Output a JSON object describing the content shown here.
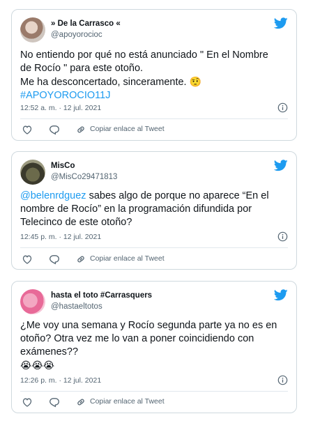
{
  "colors": {
    "link": "#1d9bf0",
    "muted": "#536471",
    "text": "#0f1419",
    "border": "#cfd9de"
  },
  "tweets": [
    {
      "display_name": "» De la Carrasco «",
      "handle": "@apoyorocioc",
      "text_line1": "No entiendo por qué no está anunciado \" En el Nombre",
      "text_line2": "de Rocío \" para este otoño.",
      "text_line3": "Me ha desconcertado, sinceramente. ",
      "emoji": "🤨",
      "hashtag": "#APOYOROCIO11J",
      "timestamp": "12:52 a. m. · 12 jul. 2021",
      "copy_label": "Copiar enlace al Tweet"
    },
    {
      "display_name": "MisCo",
      "handle": "@MisCo29471813",
      "mention": "@belenrdguez",
      "text_line1_rest": " sabes algo de porque no aparece “En el",
      "text_line2": "nombre de Rocío” en la programación difundida por",
      "text_line3": "Telecinco de este otoño?",
      "timestamp": "12:45 p. m. · 12 jul. 2021",
      "copy_label": "Copiar enlace al Tweet"
    },
    {
      "display_name": "hasta el toto #Carrasquers",
      "handle": "@hastaeltotos",
      "text_line1": "¿Me voy una semana y Rocío segunda parte ya no es en",
      "text_line2": "otoño? Otra vez me lo van a poner coincidiendo con",
      "text_line3": "exámenes??",
      "emoji": "😭😭😭",
      "timestamp": "12:26 p. m. · 12 jul. 2021",
      "copy_label": "Copiar enlace al Tweet"
    }
  ]
}
